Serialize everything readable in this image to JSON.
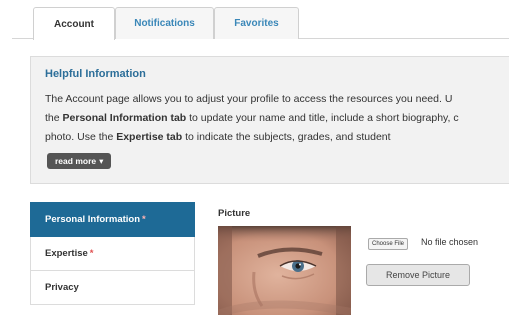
{
  "tabs": [
    {
      "label": "Account",
      "active": true
    },
    {
      "label": "Notifications",
      "active": false
    },
    {
      "label": "Favorites",
      "active": false
    }
  ],
  "info": {
    "title": "Helpful Information",
    "line1": "The Account page allows you to adjust your profile to access the resources you need.  U",
    "line2_pre": "the ",
    "line2_bold": "Personal Information tab",
    "line2_post": " to update your name and title, include a short biography, c",
    "line3_pre": "photo.  Use the ",
    "line3_bold": "Expertise tab",
    "line3_post": " to indicate the subjects, grades, and student",
    "read_more_label": "read more",
    "read_more_icon": "caret-down-icon"
  },
  "side_nav": [
    {
      "label": "Personal Information",
      "required": true,
      "active": true
    },
    {
      "label": "Expertise",
      "required": true,
      "active": false
    },
    {
      "label": "Privacy",
      "required": false,
      "active": false
    }
  ],
  "picture": {
    "label": "Picture",
    "choose_file_label": "Choose File",
    "file_status": "No file chosen",
    "remove_label": "Remove Picture"
  },
  "colors": {
    "primary": "#1e6a96",
    "link": "#3a87b8",
    "required": "#e05050"
  }
}
